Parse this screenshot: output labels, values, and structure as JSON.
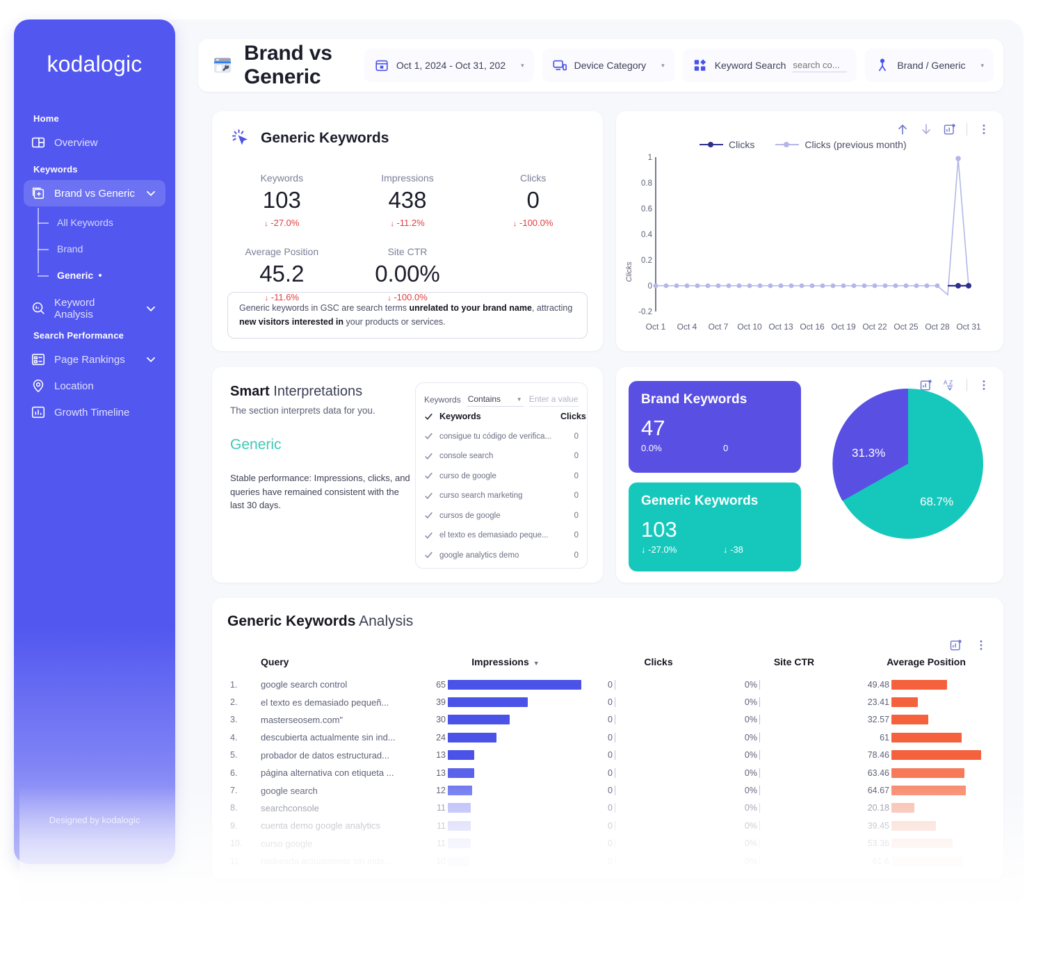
{
  "brand": {
    "logo": "kodalogic",
    "footer": "Designed by kodalogic"
  },
  "sidebar": {
    "sections": [
      {
        "label": "Home",
        "items": [
          {
            "label": "Overview",
            "icon": "overview-icon",
            "chevron": false
          }
        ]
      },
      {
        "label": "Keywords",
        "items": [
          {
            "label": "Brand vs Generic",
            "icon": "brand-generic-icon",
            "chevron": true,
            "active": true
          }
        ]
      },
      {
        "label": "Search Performance",
        "items": [
          {
            "label": "Page Rankings",
            "icon": "page-rankings-icon",
            "chevron": true
          },
          {
            "label": "Location",
            "icon": "location-pin-icon",
            "chevron": false
          },
          {
            "label": "Growth Timeline",
            "icon": "bar-chart-icon",
            "chevron": false
          }
        ]
      }
    ],
    "subitems": [
      {
        "label": "All Keywords",
        "current": false
      },
      {
        "label": "Brand",
        "current": false
      },
      {
        "label": "Generic",
        "current": true
      }
    ],
    "keyword_analysis": {
      "label": "Keyword Analysis",
      "icon": "keyword-analysis-icon",
      "chevron": true
    }
  },
  "header": {
    "title": "Brand vs Generic",
    "filters": [
      {
        "name": "date-range",
        "icon": "calendar-icon",
        "label": "Oct 1, 2024 - Oct 31, 202",
        "caret": "▾"
      },
      {
        "name": "device-category",
        "icon": "device-icon",
        "label": "Device Category",
        "caret": "▾"
      },
      {
        "name": "keyword-search",
        "icon": "keyword-icon",
        "label": "Keyword Search",
        "placeholder": "search co...",
        "value": ""
      },
      {
        "name": "brand-generic",
        "icon": "person-icon",
        "label": "Brand / Generic",
        "caret": "▾"
      }
    ]
  },
  "kpi_card": {
    "title": "Generic Keywords",
    "icon": "click-cursor-icon",
    "metrics": [
      {
        "label": "Keywords",
        "value": "103",
        "delta": "-27.0%"
      },
      {
        "label": "Impressions",
        "value": "438",
        "delta": "-11.2%"
      },
      {
        "label": "Clicks",
        "value": "0",
        "delta": "-100.0%"
      },
      {
        "label": "Average Position",
        "value": "45.2",
        "delta": "-11.6%"
      },
      {
        "label": "Site CTR",
        "value": "0.00%",
        "delta": "-100.0%"
      }
    ],
    "note": {
      "p1": "Generic keywords in GSC are search terms ",
      "b1": "unrelated to your brand name",
      "p2": ", attracting ",
      "b2": "new visitors interested in",
      "p3": " your products or services."
    }
  },
  "line_chart_tools": [
    "sort-ascending-icon",
    "sort-descending-icon",
    "export-chart-icon",
    "more-options-icon"
  ],
  "split_card_tools": [
    "export-chart-icon",
    "sort-alpha-icon",
    "more-options-icon"
  ],
  "table_tools": [
    "export-chart-icon",
    "more-options-icon"
  ],
  "smart": {
    "title_bold": "Smart",
    "title_rest": " Interpretations",
    "subtitle": "The section interprets data for you.",
    "tag": "Generic",
    "body": "Stable performance: Impressions, clicks, and queries have remained consistent with the last 30 days.",
    "filter": {
      "label": "Keywords",
      "operator": "Contains",
      "placeholder": "Enter a value",
      "value": ""
    },
    "columns": {
      "name": "Keywords",
      "clicks": "Clicks"
    },
    "rows": [
      {
        "name": "consigue tu código de verifica...",
        "clicks": "0"
      },
      {
        "name": "console search",
        "clicks": "0"
      },
      {
        "name": "curso de google",
        "clicks": "0"
      },
      {
        "name": "curso search marketing",
        "clicks": "0"
      },
      {
        "name": "cursos de google",
        "clicks": "0"
      },
      {
        "name": "el texto es demasiado peque...",
        "clicks": "0"
      },
      {
        "name": "google analytics demo",
        "clicks": "0"
      }
    ]
  },
  "split": {
    "brand": {
      "title": "Brand Keywords",
      "count": "47",
      "delta": "0.0%",
      "change": "0",
      "color": "#5a4fe3"
    },
    "generic": {
      "title": "Generic Keywords",
      "count": "103",
      "delta": "-27.0%",
      "change": "-38",
      "color": "#16c8bc"
    }
  },
  "chart_data": [
    {
      "type": "line",
      "title": "",
      "xlabel": "",
      "ylabel": "Clicks",
      "ylim": [
        -0.2,
        1
      ],
      "yticks": [
        -0.2,
        0,
        0.2,
        0.4,
        0.6,
        0.8,
        1
      ],
      "ytick_labels": [
        "-0.2",
        "0",
        "0.2",
        "0.4",
        "0.6",
        "0.8",
        "1"
      ],
      "xtick_labels": [
        "Oct 1",
        "Oct 4",
        "Oct 7",
        "Oct 10",
        "Oct 13",
        "Oct 16",
        "Oct 19",
        "Oct 22",
        "Oct 25",
        "Oct 28",
        "Oct 31"
      ],
      "grid": false,
      "legend_position": "top-left",
      "series": [
        {
          "name": "Clicks",
          "color": "#2b2f8f",
          "x": [
            "Oct 28",
            "Oct 29",
            "Oct 30",
            "Oct 31"
          ],
          "values": [
            0,
            0,
            0,
            0
          ]
        },
        {
          "name": "Clicks (previous month)",
          "color": "#b3b6e8",
          "x": [
            "Oct 1",
            "Oct 2",
            "Oct 3",
            "Oct 4",
            "Oct 5",
            "Oct 6",
            "Oct 7",
            "Oct 8",
            "Oct 9",
            "Oct 10",
            "Oct 11",
            "Oct 12",
            "Oct 13",
            "Oct 14",
            "Oct 15",
            "Oct 16",
            "Oct 17",
            "Oct 18",
            "Oct 19",
            "Oct 20",
            "Oct 21",
            "Oct 22",
            "Oct 23",
            "Oct 24",
            "Oct 25",
            "Oct 26",
            "Oct 27",
            "Oct 28",
            "Oct 29",
            "Oct 30",
            "Oct 31"
          ],
          "values": [
            0,
            0,
            0,
            0,
            0,
            0,
            0,
            0,
            0,
            0,
            0,
            0,
            0,
            0,
            0,
            0,
            0,
            0,
            0,
            0,
            0,
            0,
            0,
            0,
            0,
            0,
            0,
            0,
            -0.07,
            1,
            0
          ]
        }
      ]
    },
    {
      "type": "pie",
      "title": "",
      "labels": [
        "Brand Keywords",
        "Generic Keywords"
      ],
      "values": [
        31.3,
        68.7
      ],
      "display_labels": [
        "31.3%",
        "68.7%"
      ],
      "colors": [
        "#5a4fe3",
        "#16c8bc"
      ],
      "legend_position": "none"
    },
    {
      "type": "bar",
      "title": "Generic Keywords Analysis",
      "orientation": "horizontal",
      "columns": [
        "Query",
        "Impressions",
        "Clicks",
        "Site CTR",
        "Average Position"
      ],
      "sorted_by": "Impressions",
      "categories": [
        "google search control",
        "el texto es demasiado pequeñ...",
        "masterseosem.com\"",
        "descubierta actualmente sin ind...",
        "probador de datos estructurad...",
        "página alternativa con etiqueta ...",
        "google search",
        "searchconsole",
        "cuenta demo google analytics",
        "curso google",
        "rastreada actualmente sin inde..."
      ],
      "series": [
        {
          "name": "Impressions",
          "color": "#4a52e8",
          "values": [
            65,
            39,
            30,
            24,
            13,
            13,
            12,
            11,
            11,
            11,
            10
          ]
        },
        {
          "name": "Clicks",
          "color": "#4a52e8",
          "values": [
            0,
            0,
            0,
            0,
            0,
            0,
            0,
            0,
            0,
            0,
            0
          ]
        },
        {
          "name": "Site CTR",
          "color": "#4a52e8",
          "display": [
            "0%",
            "0%",
            "0%",
            "0%",
            "0%",
            "0%",
            "0%",
            "0%",
            "0%",
            "0%",
            "0%"
          ],
          "values": [
            0,
            0,
            0,
            0,
            0,
            0,
            0,
            0,
            0,
            0,
            0
          ]
        },
        {
          "name": "Average Position",
          "color": "#f4613c",
          "display": [
            "49.48",
            "23.41",
            "32.57",
            "61",
            "78.46",
            "63.46",
            "64.67",
            "20.18",
            "39.45",
            "53.36",
            "61.6"
          ],
          "values": [
            49.48,
            23.41,
            32.57,
            61,
            78.46,
            63.46,
            64.67,
            20.18,
            39.45,
            53.36,
            61.6
          ]
        }
      ],
      "row_numbers": [
        "1.",
        "2.",
        "3.",
        "4.",
        "5.",
        "6.",
        "7.",
        "8.",
        "9.",
        "10.",
        "11."
      ]
    }
  ]
}
